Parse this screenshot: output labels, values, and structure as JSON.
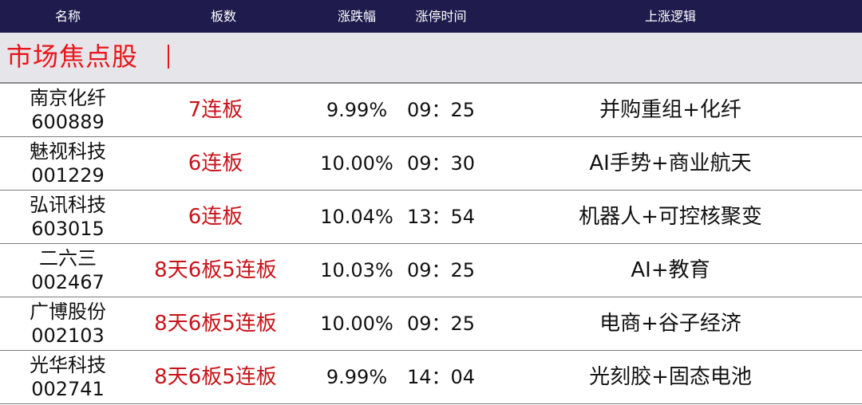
{
  "header": {
    "col_name": "名称",
    "col_boards": "板数",
    "col_change": "涨跌幅",
    "col_time": "涨停时间",
    "col_logic": "上涨逻辑"
  },
  "section": {
    "title": "市场焦点股"
  },
  "rows": [
    {
      "name": "南京化纤",
      "code": "600889",
      "boards": "7连板",
      "change": "9.99%",
      "time": "09：25",
      "logic": "并购重组+化纤"
    },
    {
      "name": "魅视科技",
      "code": "001229",
      "boards": "6连板",
      "change": "10.00%",
      "time": "09：30",
      "logic": "AI手势+商业航天"
    },
    {
      "name": "弘讯科技",
      "code": "603015",
      "boards": "6连板",
      "change": "10.04%",
      "time": "13：54",
      "logic": "机器人+可控核聚变"
    },
    {
      "name": "二六三",
      "code": "002467",
      "boards": "8天6板5连板",
      "change": "10.03%",
      "time": "09：25",
      "logic": "AI+教育"
    },
    {
      "name": "广博股份",
      "code": "002103",
      "boards": "8天6板5连板",
      "change": "10.00%",
      "time": "09：25",
      "logic": "电商+谷子经济"
    },
    {
      "name": "光华科技",
      "code": "002741",
      "boards": "8天6板5连板",
      "change": "9.99%",
      "time": "14：04",
      "logic": "光刻胶+固态电池"
    }
  ],
  "colors": {
    "header_bg": "#1f1b4d",
    "accent_red": "#e8151b",
    "board_red": "#c8141a",
    "section_bg": "#e6e6ea"
  }
}
